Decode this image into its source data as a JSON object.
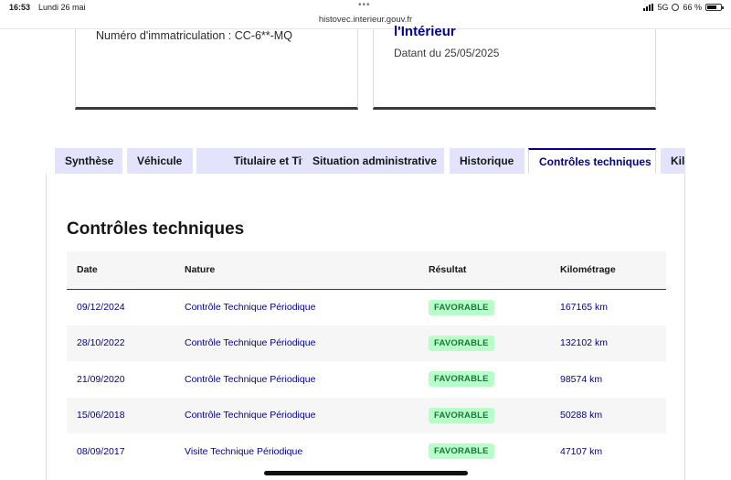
{
  "status_bar": {
    "time": "16:53",
    "date": "Lundi 26 mai",
    "url": "histovec.interieur.gouv.fr",
    "network": "5G",
    "battery": "66 %"
  },
  "cards": {
    "left": {
      "plate": "Numéro d'immatriculation : CC-6**-MQ"
    },
    "right": {
      "ministry": "l'Intérieur",
      "dated": "Datant du 25/05/2025"
    }
  },
  "tabs": [
    {
      "label": "Synthèse"
    },
    {
      "label": "Véhicule"
    },
    {
      "label": "Titulaire et Titre"
    },
    {
      "label": "Situation administrative"
    },
    {
      "label": "Historique"
    },
    {
      "label": "Contrôles techniques",
      "active": true
    },
    {
      "label": "Kilo"
    }
  ],
  "section": {
    "title": "Contrôles techniques",
    "headers": {
      "date": "Date",
      "nature": "Nature",
      "result": "Résultat",
      "mileage": "Kilométrage"
    },
    "rows": [
      {
        "date": "09/12/2024",
        "nature": "Contrôle Technique Périodique",
        "result": "FAVORABLE",
        "mileage": "167165 km"
      },
      {
        "date": "28/10/2022",
        "nature": "Contrôle Technique Périodique",
        "result": "FAVORABLE",
        "mileage": "132102 km"
      },
      {
        "date": "21/09/2020",
        "nature": "Contrôle Technique Périodique",
        "result": "FAVORABLE",
        "mileage": "98574 km"
      },
      {
        "date": "15/06/2018",
        "nature": "Contrôle Technique Périodique",
        "result": "FAVORABLE",
        "mileage": "50288 km"
      },
      {
        "date": "08/09/2017",
        "nature": "Visite Technique Périodique",
        "result": "FAVORABLE",
        "mileage": "47107 km"
      }
    ]
  },
  "colors": {
    "accent": "#000091",
    "tab_bg": "#e3e3fd",
    "success_bg": "#b8fec9",
    "success_text": "#18753c"
  }
}
